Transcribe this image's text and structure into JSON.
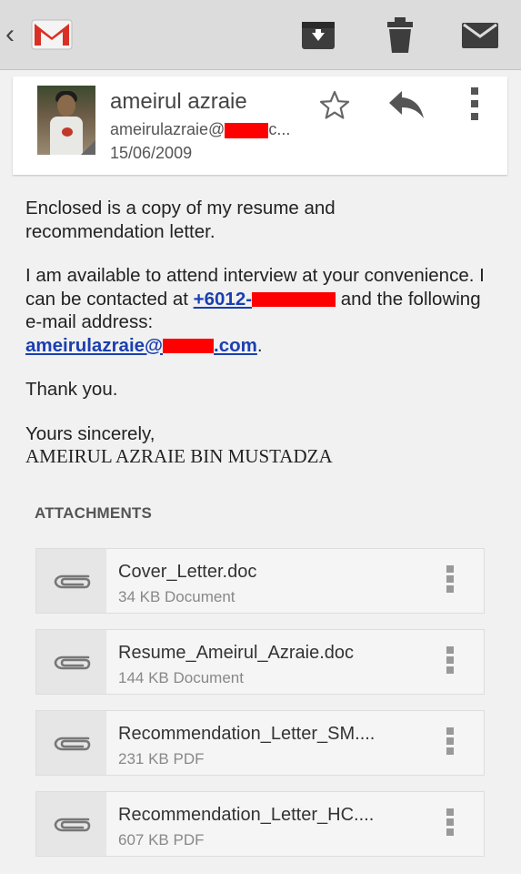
{
  "toolbar": {
    "back_glyph": "‹",
    "icons": [
      "gmail-logo-icon",
      "archive-icon",
      "trash-icon",
      "mark-unread-icon"
    ]
  },
  "header": {
    "sender_name": "ameirul azraie",
    "sender_email_prefix": "ameirulazraie@",
    "sender_email_suffix": "c...",
    "date": "15/06/2009",
    "actions": [
      "star-icon",
      "reply-icon",
      "more-vert-icon"
    ]
  },
  "body": {
    "para1": "Enclosed is a copy of my resume and recommendation letter.",
    "para2_text": "I am available to attend interview at your convenience. I can be contacted at",
    "phone_prefix": "+6012-",
    "para2_mid": "and the following e-mail address:",
    "email_prefix": "ameirulazraie@",
    "email_suffix": ".com",
    "email_end": ".",
    "thanks": "Thank you.",
    "closing": "Yours sincerely,",
    "signature": "AMEIRUL AZRAIE BIN MUSTADZA"
  },
  "attachments_heading": "ATTACHMENTS",
  "attachments": [
    {
      "name": "Cover_Letter.doc",
      "meta": "34 KB Document"
    },
    {
      "name": "Resume_Ameirul_Azraie.doc",
      "meta": "144 KB Document"
    },
    {
      "name": "Recommendation_Letter_SM....",
      "meta": "231 KB PDF"
    },
    {
      "name": "Recommendation_Letter_HC....",
      "meta": "607 KB PDF"
    }
  ],
  "colors": {
    "redaction": "#ff0000",
    "link": "#1a3fb0",
    "gmail_red": "#d93025"
  }
}
